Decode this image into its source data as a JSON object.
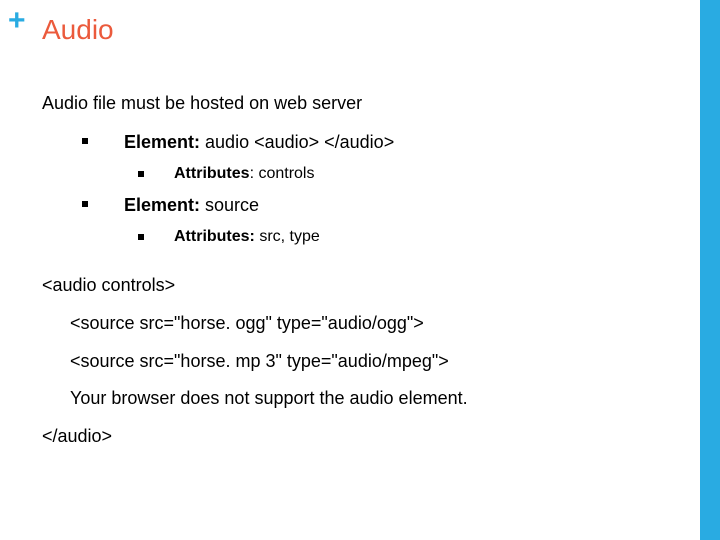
{
  "decor": {
    "plus": "+"
  },
  "title": "Audio",
  "intro": "Audio file must be hosted on web server",
  "items": {
    "l1a_label": "Element:",
    "l1a_rest": "  audio <audio>  </audio>",
    "l2a_label": "Attributes",
    "l2a_rest": ": controls",
    "l1b_label": "Element:",
    "l1b_rest": "  source",
    "l2b_label": "Attributes:",
    "l2b_rest": "  src, type"
  },
  "code": {
    "open": "<audio controls>",
    "src1": "<source src=\"horse. ogg\" type=\"audio/ogg\">",
    "src2": "<source src=\"horse. mp 3\" type=\"audio/mpeg\">",
    "fallback": "Your browser does not support the audio element.",
    "close": "</audio>"
  }
}
